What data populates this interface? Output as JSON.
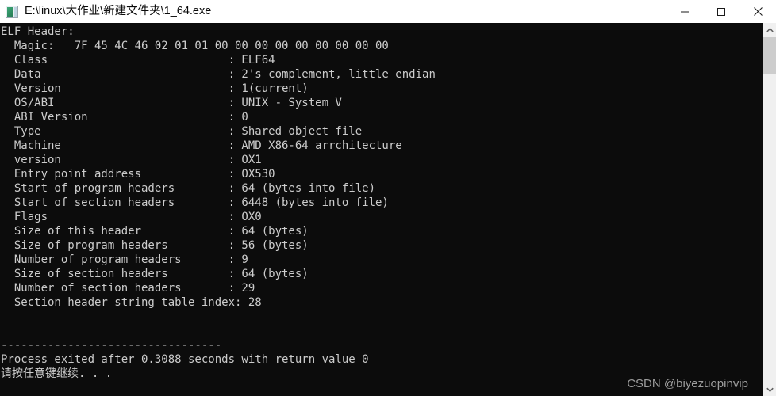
{
  "window": {
    "title": "E:\\linux\\大作业\\新建文件夹\\1_64.exe",
    "icon": "console-app-icon",
    "background_color": "#0c0c0c",
    "text_color": "#cccccc",
    "titlebar_color": "#ffffff"
  },
  "titlebar_controls": {
    "minimize_label": "Minimize",
    "maximize_label": "Maximize",
    "close_label": "Close"
  },
  "console": {
    "lines": [
      "ELF Header:",
      "  Magic:   7F 45 4C 46 02 01 01 00 00 00 00 00 00 00 00 00",
      "  Class                           : ELF64",
      "  Data                            : 2's complement, little endian",
      "  Version                         : 1(current)",
      "  OS/ABI                          : UNIX - System V",
      "  ABI Version                     : 0",
      "  Type                            : Shared object file",
      "  Machine                         : AMD X86-64 arrchitecture",
      "  version                         : OX1",
      "  Entry point address             : OX530",
      "  Start of program headers        : 64 (bytes into file)",
      "  Start of section headers        : 6448 (bytes into file)",
      "  Flags                           : OX0",
      "  Size of this header             : 64 (bytes)",
      "  Size of program headers         : 56 (bytes)",
      "  Number of program headers       : 9",
      "  Size of section headers         : 64 (bytes)",
      "  Number of section headers       : 29",
      "  Section header string table index: 28",
      "",
      "",
      "---------------------------------",
      "Process exited after 0.3088 seconds with return value 0",
      "请按任意键继续. . ."
    ]
  },
  "scrollbar": {
    "up_arrow_label": "Scroll up",
    "down_arrow_label": "Scroll down",
    "thumb_label": "Scroll thumb"
  },
  "watermark": {
    "text": "CSDN @biyezuopinvip"
  }
}
